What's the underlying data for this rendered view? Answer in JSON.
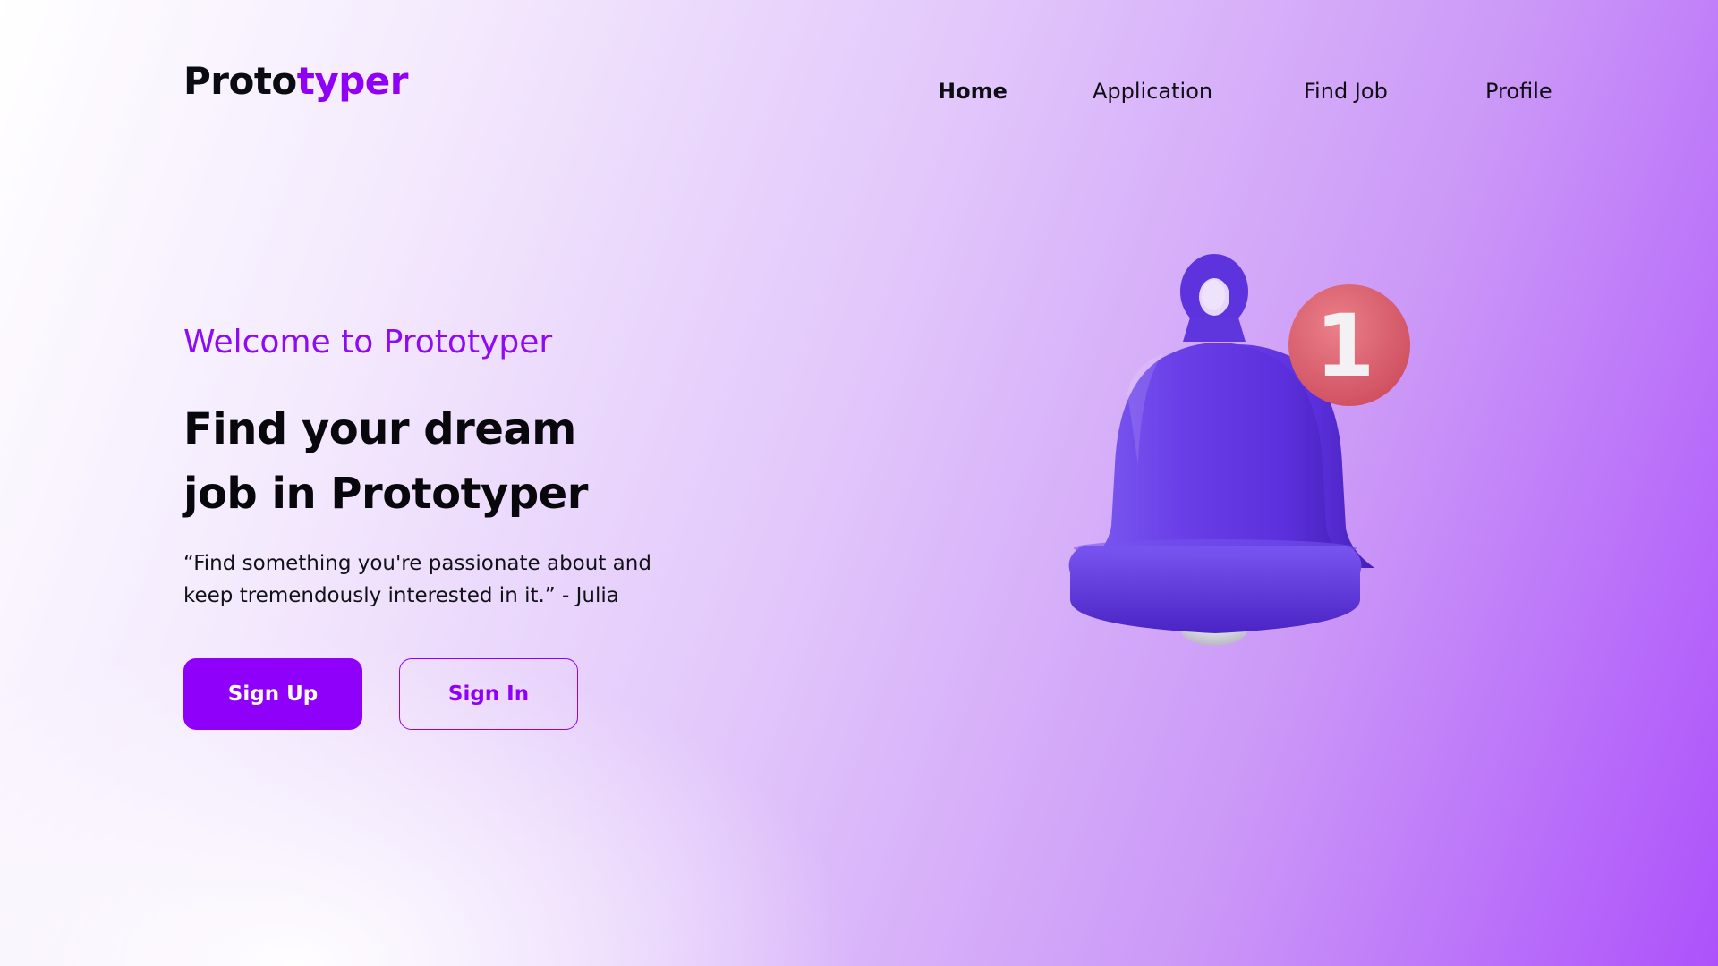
{
  "brand": {
    "name_part1": "Proto",
    "name_part2": "typer",
    "accent_color": "#8f00f7"
  },
  "nav": {
    "items": [
      {
        "label": "Home",
        "active": true
      },
      {
        "label": "Application",
        "active": false
      },
      {
        "label": "Find Job",
        "active": false
      },
      {
        "label": "Profile",
        "active": false
      }
    ]
  },
  "hero": {
    "welcome": "Welcome to Prototyper",
    "headline_line1": "Find your dream",
    "headline_line2": "job in Prototyper",
    "quote_line1": "“Find something you're passionate about and",
    "quote_line2": "keep tremendously interested in it.” - Julia",
    "signup_label": "Sign Up",
    "signin_label": "Sign In"
  },
  "illustration": {
    "icon": "bell-icon",
    "badge_count": "1",
    "bell_color": "#6a3ce6",
    "badge_color": "#e06a78"
  }
}
